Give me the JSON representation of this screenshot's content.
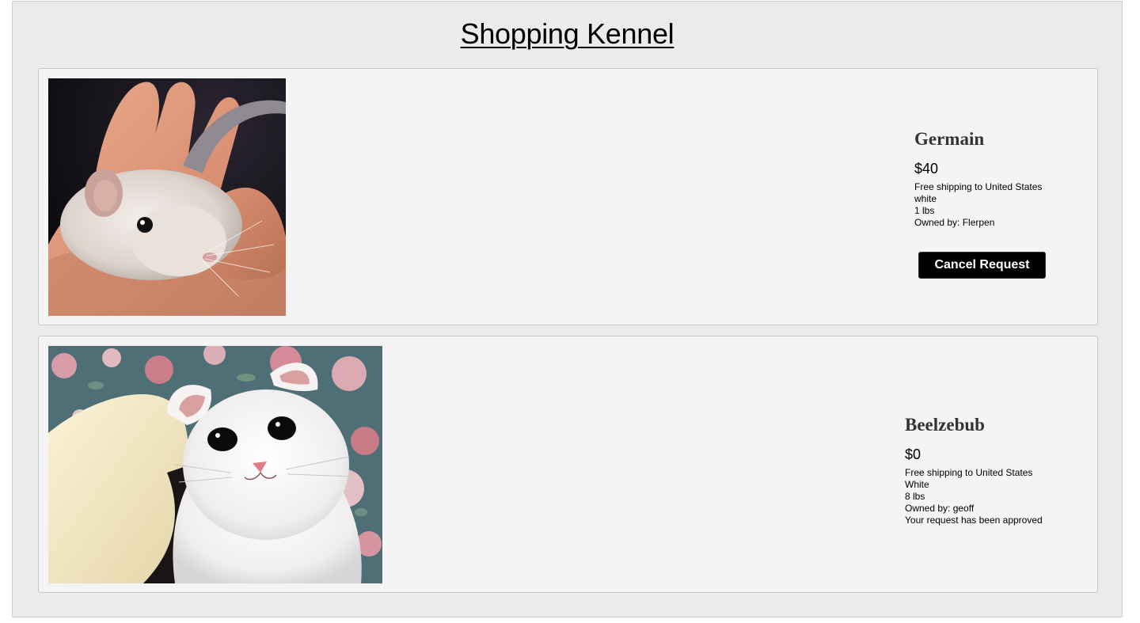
{
  "header": {
    "title": "Shopping Kennel"
  },
  "listings": [
    {
      "image_subject": "white mouse in hand",
      "name": "Germain",
      "price": "$40",
      "shipping": "Free shipping to United States",
      "color": "white",
      "weight": "1 lbs",
      "owner": "Owned by: Flerpen",
      "action_label": "Cancel Request"
    },
    {
      "image_subject": "white scottish fold kitten",
      "name": "Beelzebub",
      "price": "$0",
      "shipping": "Free shipping to United States",
      "color": "White",
      "weight": "8 lbs",
      "owner": "Owned by: geoff",
      "status": "Your request has been approved"
    }
  ],
  "colors": {
    "page_background": "#ebebeb",
    "card_background": "#f4f4f4",
    "button_background": "#000000",
    "button_text": "#ffffff"
  }
}
